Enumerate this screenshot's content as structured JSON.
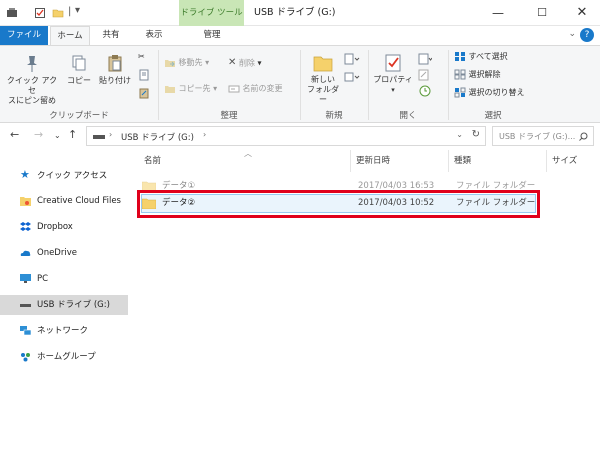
{
  "window": {
    "context_tab": "ドライブ ツール",
    "title": "USB ドライブ (G:)"
  },
  "tabs": {
    "file": "ファイル",
    "home": "ホーム",
    "share": "共有",
    "view": "表示",
    "manage": "管理"
  },
  "ribbon": {
    "quick_access_pin": "クイック アクセ\nスにピン留め",
    "copy": "コピー",
    "paste": "貼り付け",
    "group_clipboard": "クリップボード",
    "move_to": "移動先",
    "copy_to": "コピー先",
    "delete": "削除",
    "rename": "名前の変更",
    "group_organize": "整理",
    "new_folder": "新しい\nフォルダー",
    "group_new": "新規",
    "properties": "プロパティ",
    "group_open": "開く",
    "select_all": "すべて選択",
    "select_none": "選択解除",
    "invert_selection": "選択の切り替え",
    "group_select": "選択"
  },
  "address": {
    "path": "USB ドライブ (G:)",
    "search_placeholder": "USB ドライブ (G:)..."
  },
  "nav": {
    "items": [
      {
        "label": "クイック アクセス"
      },
      {
        "label": "Creative Cloud Files"
      },
      {
        "label": "Dropbox"
      },
      {
        "label": "OneDrive"
      },
      {
        "label": "PC"
      },
      {
        "label": "USB ドライブ (G:)"
      },
      {
        "label": "ネットワーク"
      },
      {
        "label": "ホームグループ"
      }
    ]
  },
  "columns": {
    "name": "名前",
    "modified": "更新日時",
    "type": "種類",
    "size": "サイズ"
  },
  "files": [
    {
      "name": "データ①",
      "modified": "2017/04/03 16:53",
      "type": "ファイル フォルダー"
    },
    {
      "name": "データ②",
      "modified": "2017/04/03 10:52",
      "type": "ファイル フォルダー"
    }
  ],
  "colors": {
    "accent": "#1979ca",
    "context_tab_bg": "#c9e6b6",
    "highlight": "#e0001b",
    "folder": "#f5d16b"
  }
}
